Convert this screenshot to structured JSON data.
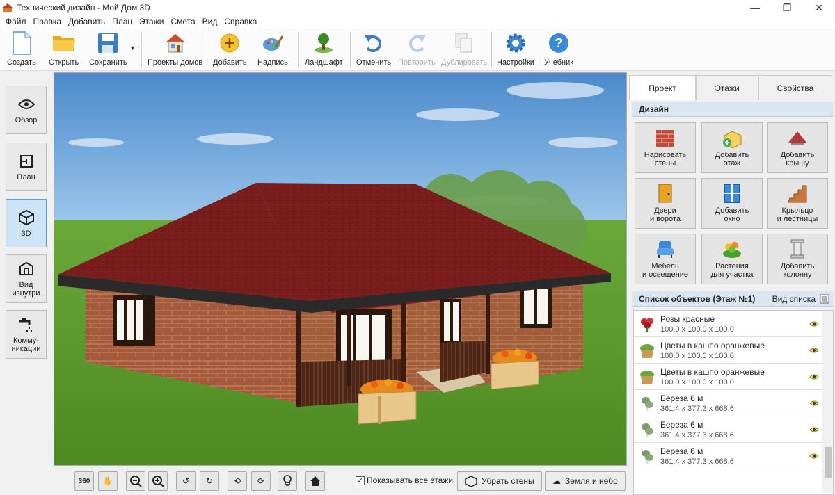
{
  "window": {
    "title": "Технический дизайн - Мой Дом 3D"
  },
  "menu": [
    "Файл",
    "Правка",
    "Добавить",
    "План",
    "Этажи",
    "Смета",
    "Вид",
    "Справка"
  ],
  "toolbar": {
    "create": "Создать",
    "open": "Открыть",
    "save": "Сохранить",
    "projects": "Проекты домов",
    "add": "Добавить",
    "text": "Надпись",
    "landscape": "Ландшафт",
    "undo": "Отменить",
    "redo": "Повторить",
    "duplicate": "Дублировать",
    "settings": "Настройки",
    "tutorial": "Учебник"
  },
  "left": {
    "overview": "Обзор",
    "plan": "План",
    "view3d": "3D",
    "inside_1": "Вид",
    "inside_2": "изнутри",
    "comm_1": "Комму-",
    "comm_2": "никации"
  },
  "bottom": {
    "show_floors": "Показывать все этажи",
    "remove_walls": "Убрать стены",
    "ground_sky": "Земля и небо",
    "rotate360": "360"
  },
  "right": {
    "tabs": [
      "Проект",
      "Этажи",
      "Свойства"
    ],
    "design_title": "Дизайн",
    "design": [
      [
        "Нарисовать",
        "стены"
      ],
      [
        "Добавить",
        "этаж"
      ],
      [
        "Добавить",
        "крышу"
      ],
      [
        "Двери",
        "и ворота"
      ],
      [
        "Добавить",
        "окно"
      ],
      [
        "Крыльцо",
        "и лестницы"
      ],
      [
        "Мебель",
        "и освещение"
      ],
      [
        "Растения",
        "для участка"
      ],
      [
        "Добавить",
        "колонну"
      ]
    ],
    "list_title": "Список объектов (Этаж №1)",
    "list_view": "Вид списка",
    "objects": [
      {
        "name": "Розы красные",
        "dims": "100.0 x 100.0 x 100.0"
      },
      {
        "name": "Цветы в кашпо оранжевые",
        "dims": "100.0 x 100.0 x 100.0"
      },
      {
        "name": "Цветы в кашпо оранжевые",
        "dims": "100.0 x 100.0 x 100.0"
      },
      {
        "name": "Береза 6 м",
        "dims": "361.4 x 377.3 x 668.6"
      },
      {
        "name": "Береза 6 м",
        "dims": "361.4 x 377.3 x 668.6"
      },
      {
        "name": "Береза 6 м",
        "dims": "361.4 x 377.3 x 668.6"
      }
    ]
  },
  "colors": {
    "roof": "#7a1a1a",
    "brick": "#a8583a",
    "grass": "#5e9e2e",
    "sky": "#5d9bd3",
    "accent": "#cde3f7"
  }
}
